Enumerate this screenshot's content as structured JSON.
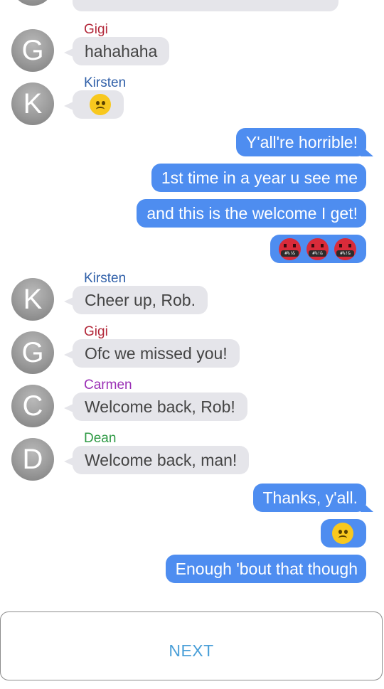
{
  "colors": {
    "incoming_bubble": "#e5e5ea",
    "outgoing_bubble": "#4e8df0",
    "sender_gigi": "#b3283a",
    "sender_kirsten": "#2f5fa8",
    "sender_carmen": "#9a2fb5",
    "sender_dean": "#2f9a45",
    "next_button_text": "#4a9fd8"
  },
  "messages": [
    {
      "id": "m1",
      "direction": "incoming",
      "sender": "Gigi",
      "avatar_letter": "G",
      "text": "hahahaha"
    },
    {
      "id": "m2",
      "direction": "incoming",
      "sender": "Kirsten",
      "avatar_letter": "K",
      "emoji": "sad-face-icon"
    },
    {
      "id": "m3",
      "direction": "outgoing",
      "text": "Y'all're horrible!"
    },
    {
      "id": "m4",
      "direction": "outgoing",
      "text": "1st time in a year u see me"
    },
    {
      "id": "m5",
      "direction": "outgoing",
      "text": "and this is the welcome I get!"
    },
    {
      "id": "m6",
      "direction": "outgoing",
      "emoji": "angry-cursing-face-icon",
      "emoji_count": 3,
      "emoji_symbol": "#%!&"
    },
    {
      "id": "m7",
      "direction": "incoming",
      "sender": "Kirsten",
      "avatar_letter": "K",
      "text": "Cheer up, Rob."
    },
    {
      "id": "m8",
      "direction": "incoming",
      "sender": "Gigi",
      "avatar_letter": "G",
      "text": "Ofc we missed you!"
    },
    {
      "id": "m9",
      "direction": "incoming",
      "sender": "Carmen",
      "avatar_letter": "C",
      "text": "Welcome back, Rob!"
    },
    {
      "id": "m10",
      "direction": "incoming",
      "sender": "Dean",
      "avatar_letter": "D",
      "text": "Welcome back, man!"
    },
    {
      "id": "m11",
      "direction": "outgoing",
      "text": "Thanks, y'all."
    },
    {
      "id": "m12",
      "direction": "outgoing",
      "emoji": "sad-face-icon"
    },
    {
      "id": "m13",
      "direction": "outgoing",
      "text": "Enough 'bout that though"
    }
  ],
  "next_button": {
    "label": "NEXT"
  }
}
